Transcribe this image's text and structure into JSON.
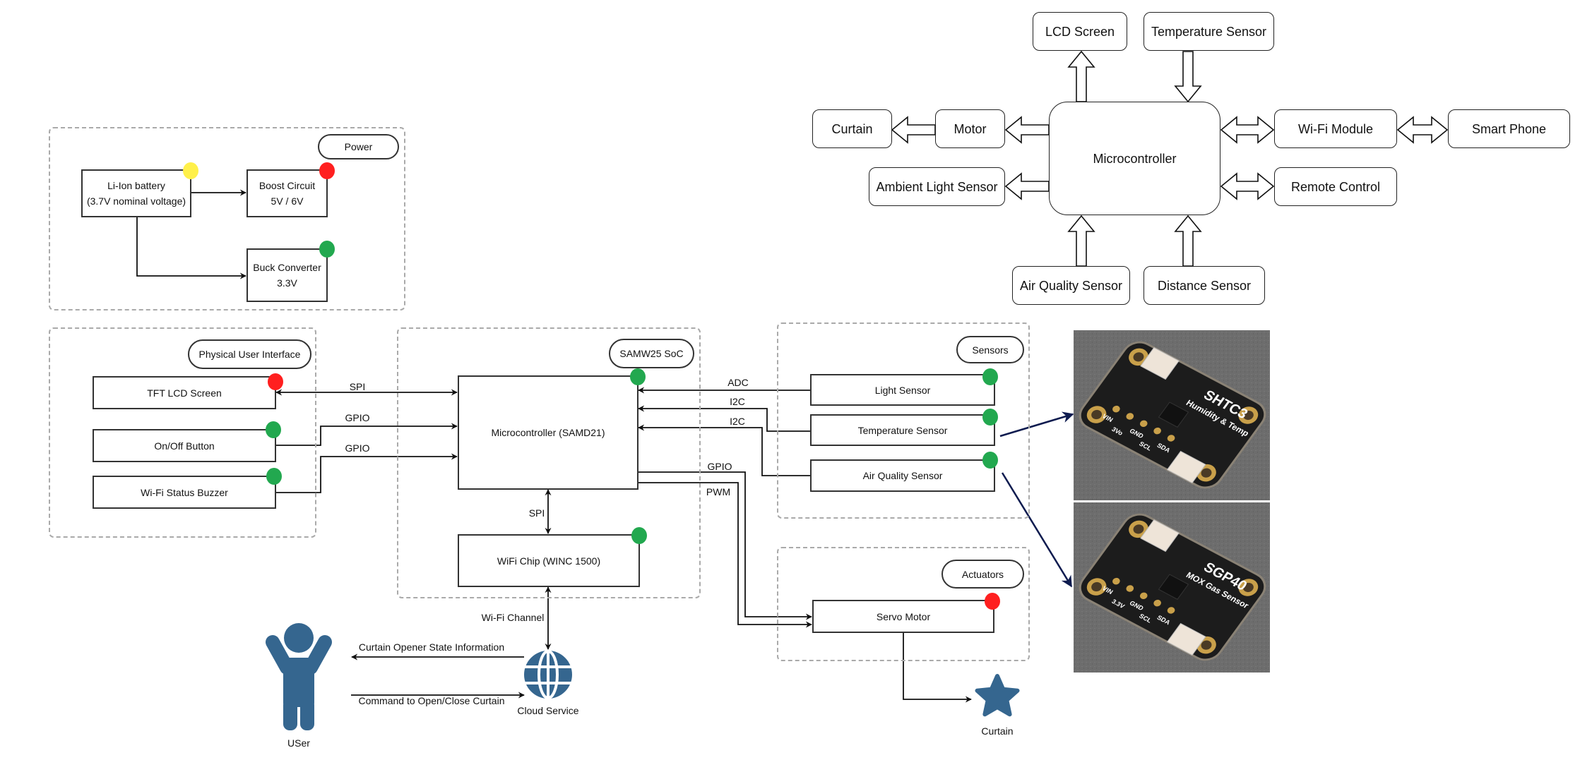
{
  "status_colors": {
    "green": "#22a84f",
    "red": "#ff1f1f",
    "yellow": "#fff04a",
    "icon_blue": "#35668f",
    "pointer_navy": "#0d1b4f"
  },
  "overview": {
    "microcontroller": "Microcontroller",
    "lcd_screen": "LCD Screen",
    "temperature_sensor": "Temperature Sensor",
    "curtain": "Curtain",
    "motor": "Motor",
    "ambient_light_sensor": "Ambient Light Sensor",
    "wifi_module": "Wi-Fi Module",
    "smart_phone": "Smart Phone",
    "remote_control": "Remote Control",
    "air_quality_sensor": "Air Quality Sensor",
    "distance_sensor": "Distance Sensor"
  },
  "power": {
    "label": "Power",
    "battery": {
      "line1": "Li-Ion battery",
      "line2": "(3.7V nominal voltage)",
      "status": "yellow"
    },
    "boost": {
      "line1": "Boost Circuit",
      "line2": "5V / 6V",
      "status": "red"
    },
    "buck": {
      "line1": "Buck Converter",
      "line2": "3.3V",
      "status": "green"
    }
  },
  "ui": {
    "label": "Physical User Interface",
    "tft": {
      "name": "TFT LCD Screen",
      "status": "red"
    },
    "button": {
      "name": "On/Off Button",
      "status": "green"
    },
    "buzzer": {
      "name": "Wi-Fi Status Buzzer",
      "status": "green"
    }
  },
  "soc": {
    "label": "SAMW25 SoC",
    "mcu": {
      "name": "Microcontroller (SAMD21)",
      "status": "green"
    },
    "wifi": {
      "name": "WiFi Chip (WINC 1500)",
      "status": "green"
    }
  },
  "sensors": {
    "label": "Sensors",
    "light": {
      "name": "Light Sensor",
      "status": "green"
    },
    "temp": {
      "name": "Temperature Sensor",
      "status": "green"
    },
    "air": {
      "name": "Air Quality Sensor",
      "status": "green"
    }
  },
  "actuators": {
    "label": "Actuators",
    "servo": {
      "name": "Servo Motor",
      "status": "red"
    }
  },
  "links": {
    "spi_tft": "SPI",
    "gpio_button": "GPIO",
    "gpio_buzzer": "GPIO",
    "spi_wifi": "SPI",
    "wifi_channel": "Wi-Fi Channel",
    "adc": "ADC",
    "i2c_temp": "I2C",
    "i2c_air": "I2C",
    "gpio_servo": "GPIO",
    "pwm_servo": "PWM",
    "state_info": "Curtain Opener State Information",
    "command": "Command to Open/Close Curtain"
  },
  "cloud": {
    "label": "Cloud Service",
    "icon": "globe-icon"
  },
  "user": {
    "label": "USer",
    "icon": "person-icon"
  },
  "curtain": {
    "label": "Curtain",
    "icon": "star-icon"
  },
  "photos": {
    "shtc3": {
      "title": "SHTC3",
      "subtitle": "Humidity & Temp",
      "pins": [
        "VIN",
        "3Vo",
        "GND",
        "SCL",
        "SDA"
      ]
    },
    "sgp40": {
      "title": "SGP40",
      "subtitle": "MOX Gas Sensor",
      "pins": [
        "VIN",
        "3.3V",
        "GND",
        "SCL",
        "SDA"
      ]
    }
  }
}
